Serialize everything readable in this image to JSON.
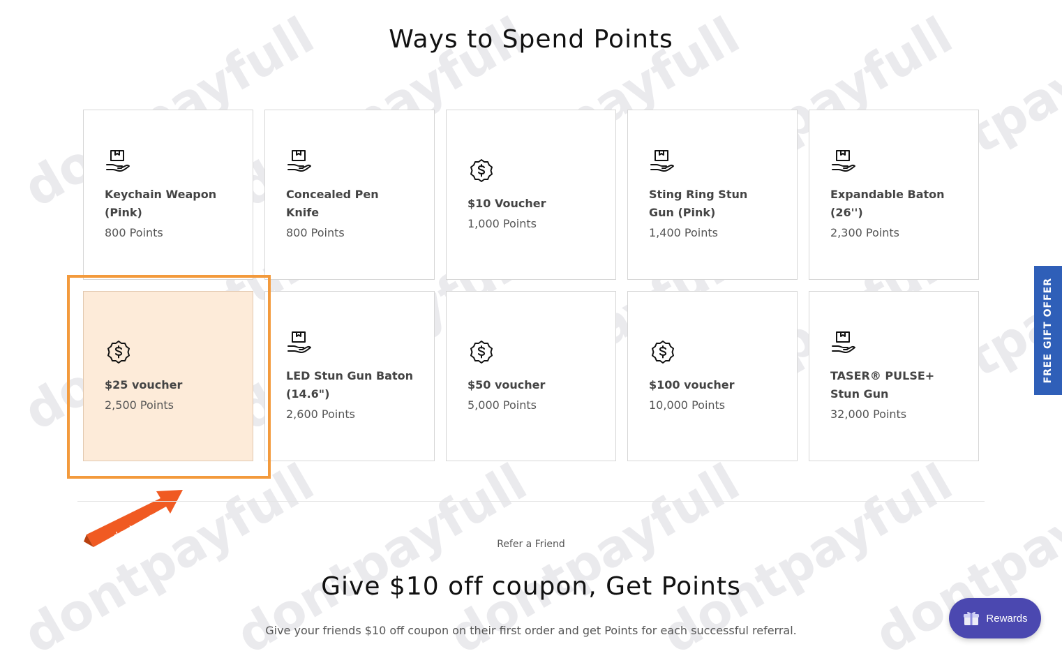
{
  "header": {
    "title": "Ways to Spend Points"
  },
  "rewards": [
    {
      "name": "Keychain Weapon (Pink)",
      "points": "800 Points",
      "icon": "product-box-hand-icon",
      "selected": false
    },
    {
      "name": "Concealed Pen Knife",
      "points": "800 Points",
      "icon": "product-box-hand-icon",
      "selected": false
    },
    {
      "name": "$10 Voucher",
      "points": "1,000 Points",
      "icon": "dollar-badge-icon",
      "selected": false
    },
    {
      "name": "Sting Ring Stun Gun (Pink)",
      "points": "1,400 Points",
      "icon": "product-box-hand-icon",
      "selected": false
    },
    {
      "name": "Expandable Baton (26'')",
      "points": "2,300 Points",
      "icon": "product-box-hand-icon",
      "selected": false
    },
    {
      "name": "$25 voucher",
      "points": "2,500 Points",
      "icon": "dollar-badge-icon",
      "selected": true
    },
    {
      "name": "LED Stun Gun Baton (14.6\")",
      "points": "2,600 Points",
      "icon": "product-box-hand-icon",
      "selected": false
    },
    {
      "name": "$50 voucher",
      "points": "5,000 Points",
      "icon": "dollar-badge-icon",
      "selected": false
    },
    {
      "name": "$100 voucher",
      "points": "10,000 Points",
      "icon": "dollar-badge-icon",
      "selected": false
    },
    {
      "name": "TASER® PULSE+ Stun Gun",
      "points": "32,000 Points",
      "icon": "product-box-hand-icon",
      "selected": false
    }
  ],
  "refer": {
    "kicker": "Refer a Friend",
    "title": "Give $10 off coupon, Get Points",
    "description": "Give your friends $10 off coupon on their first order and get Points for each successful referral."
  },
  "side_tab": {
    "label": "FREE GIFT OFFER"
  },
  "launcher": {
    "label": "Rewards"
  },
  "badge": {
    "label": "dontpayfull"
  },
  "watermark": {
    "text": "dontpayfull"
  },
  "colors": {
    "highlight": "#f39a3c",
    "side_tab": "#2f5fb8",
    "launcher": "#4b48b0",
    "selected_card": "#fdebd9"
  }
}
